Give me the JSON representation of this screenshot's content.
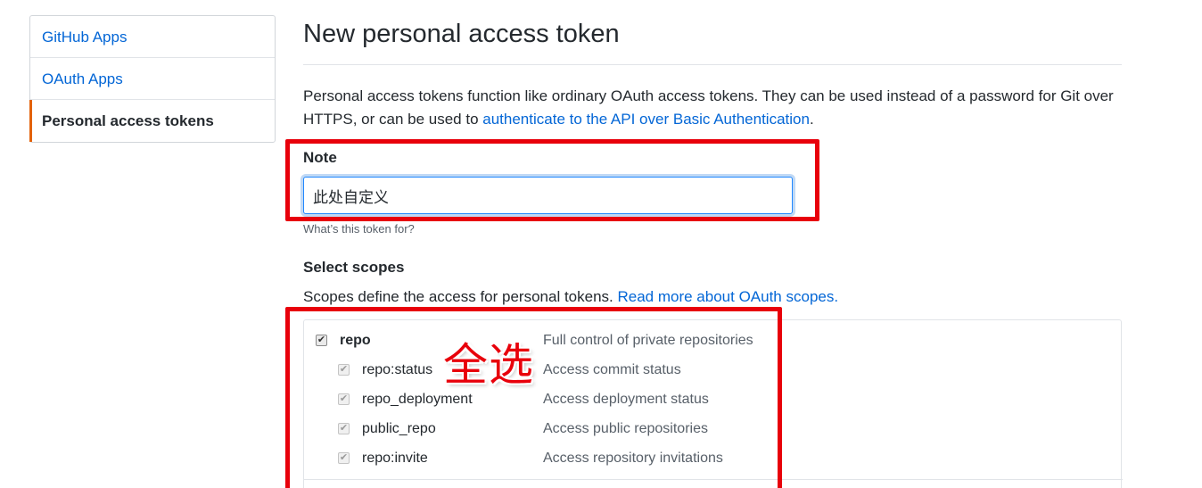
{
  "sidebar": {
    "items": [
      {
        "label": "GitHub Apps"
      },
      {
        "label": "OAuth Apps"
      },
      {
        "label": "Personal access tokens"
      }
    ]
  },
  "main": {
    "title": "New personal access token",
    "intro_text": "Personal access tokens function like ordinary OAuth access tokens. They can be used instead of a password for Git over HTTPS, or can be used to ",
    "intro_link": "authenticate to the API over Basic Authentication",
    "intro_end": "."
  },
  "note": {
    "label": "Note",
    "value": "此处自定义",
    "hint": "What’s this token for?"
  },
  "scopes": {
    "label": "Select scopes",
    "desc": "Scopes define the access for personal tokens. ",
    "link": "Read more about OAuth scopes.",
    "items": [
      {
        "name": "repo",
        "desc": "Full control of private repositories",
        "checked": true
      },
      {
        "name": "repo:status",
        "desc": "Access commit status",
        "checked": true
      },
      {
        "name": "repo_deployment",
        "desc": "Access deployment status",
        "checked": true
      },
      {
        "name": "public_repo",
        "desc": "Access public repositories",
        "checked": true
      },
      {
        "name": "repo:invite",
        "desc": "Access repository invitations",
        "checked": true
      }
    ]
  },
  "annotation": {
    "text": "全选",
    "color": "#e8000b"
  },
  "colors": {
    "link": "#0366d6",
    "selected_accent": "#e36209"
  }
}
